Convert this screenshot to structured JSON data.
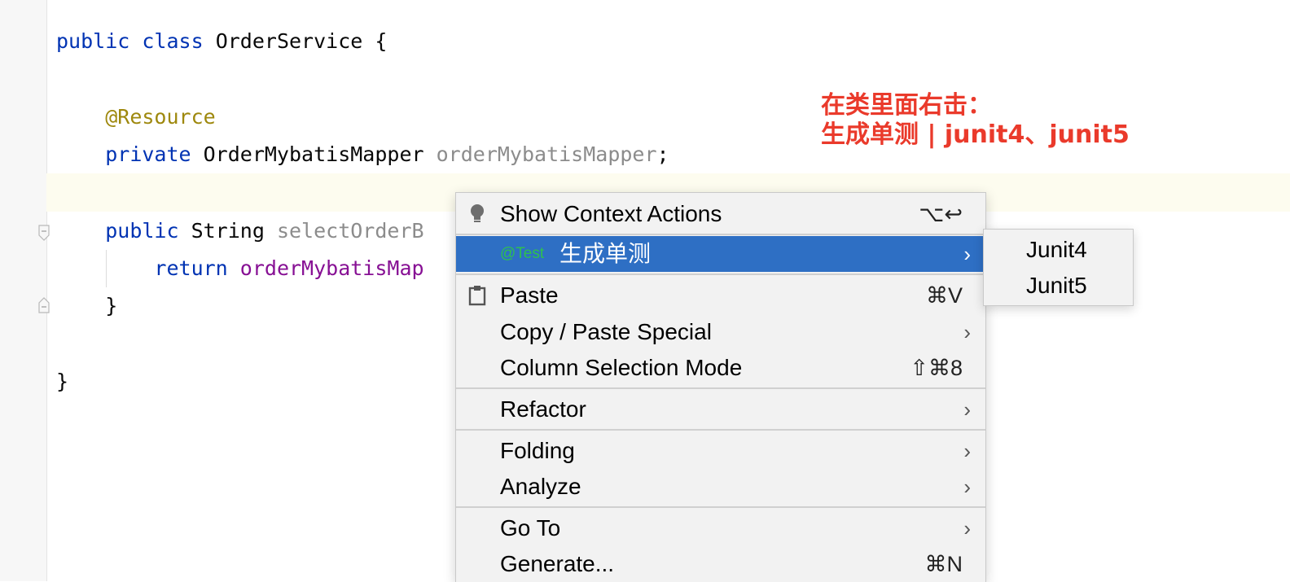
{
  "editor": {
    "lines": [
      {
        "tokens": [
          {
            "text": "public",
            "cls": "kw"
          },
          {
            "text": " ",
            "cls": "pln"
          },
          {
            "text": "class",
            "cls": "kw"
          },
          {
            "text": " OrderService {",
            "cls": "pln"
          }
        ]
      },
      {
        "tokens": [
          {
            "text": "    ",
            "cls": "pln"
          },
          {
            "text": "@Resource",
            "cls": "ann"
          }
        ]
      },
      {
        "tokens": [
          {
            "text": "    ",
            "cls": "pln"
          },
          {
            "text": "private",
            "cls": "kw"
          },
          {
            "text": " OrderMybatisMapper ",
            "cls": "pln"
          },
          {
            "text": "orderMybatisMapper",
            "cls": "gray"
          },
          {
            "text": ";",
            "cls": "pln"
          }
        ]
      },
      {
        "tokens": [
          {
            "text": "    ",
            "cls": "pln"
          },
          {
            "text": "public",
            "cls": "kw"
          },
          {
            "text": " String ",
            "cls": "pln"
          },
          {
            "text": "selectOrderB",
            "cls": "gray"
          }
        ]
      },
      {
        "tokens": [
          {
            "text": "        ",
            "cls": "pln"
          },
          {
            "text": "return",
            "cls": "kw"
          },
          {
            "text": " ",
            "cls": "pln"
          },
          {
            "text": "orderMybatisMap",
            "cls": "fld"
          }
        ]
      },
      {
        "tokens": [
          {
            "text": "    }",
            "cls": "pln"
          }
        ]
      },
      {
        "tokens": [
          {
            "text": "}",
            "cls": "pln"
          }
        ]
      }
    ]
  },
  "annotation": {
    "line1": "在类里面右击：",
    "line2": "生成单测 | junit4、junit5",
    "color": "#ea3a2b"
  },
  "context_menu": {
    "show_context_actions": {
      "label": "Show Context Actions",
      "shortcut": "⌥↩",
      "icon": "lightbulb-icon"
    },
    "generate_test": {
      "tag": "@Test",
      "label": "生成单测",
      "has_submenu": true
    },
    "paste": {
      "label": "Paste",
      "shortcut": "⌘V",
      "icon": "clipboard-icon"
    },
    "copy_paste_special": {
      "label": "Copy / Paste Special",
      "has_submenu": true
    },
    "column_selection_mode": {
      "label": "Column Selection Mode",
      "shortcut": "⇧⌘8"
    },
    "refactor": {
      "label": "Refactor",
      "has_submenu": true
    },
    "folding": {
      "label": "Folding",
      "has_submenu": true
    },
    "analyze": {
      "label": "Analyze",
      "has_submenu": true
    },
    "go_to": {
      "label": "Go To",
      "has_submenu": true
    },
    "generate": {
      "label": "Generate...",
      "shortcut": "⌘N"
    }
  },
  "submenu": {
    "items": [
      "Junit4",
      "Junit5"
    ]
  },
  "colors": {
    "selection": "#2e6fc4",
    "tag_green": "#2ec04f",
    "keyword": "#0033b3",
    "annotation": "#9e880d",
    "field": "#871094"
  }
}
